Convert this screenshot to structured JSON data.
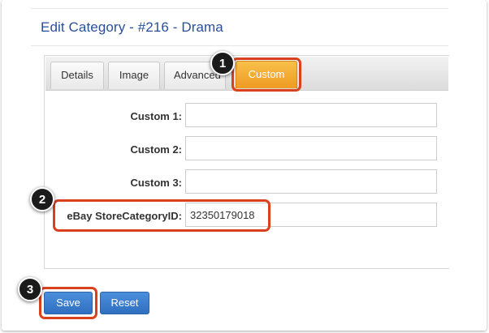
{
  "page": {
    "title": "Edit Category - #216 - Drama"
  },
  "tabs": [
    {
      "label": "Details"
    },
    {
      "label": "Image"
    },
    {
      "label": "Advanced"
    },
    {
      "label": "Custom",
      "active": true
    }
  ],
  "form": {
    "custom1": {
      "label": "Custom 1:",
      "value": ""
    },
    "custom2": {
      "label": "Custom 2:",
      "value": ""
    },
    "custom3": {
      "label": "Custom 3:",
      "value": ""
    },
    "ebay": {
      "label": "eBay StoreCategoryID:",
      "value": "32350179018"
    }
  },
  "buttons": {
    "save": "Save",
    "reset": "Reset"
  },
  "callouts": [
    "1",
    "2",
    "3"
  ],
  "colors": {
    "accent": "#ee9a22",
    "highlight": "#d9401c",
    "button": "#2f6fc0",
    "title": "#2a4f9a"
  }
}
